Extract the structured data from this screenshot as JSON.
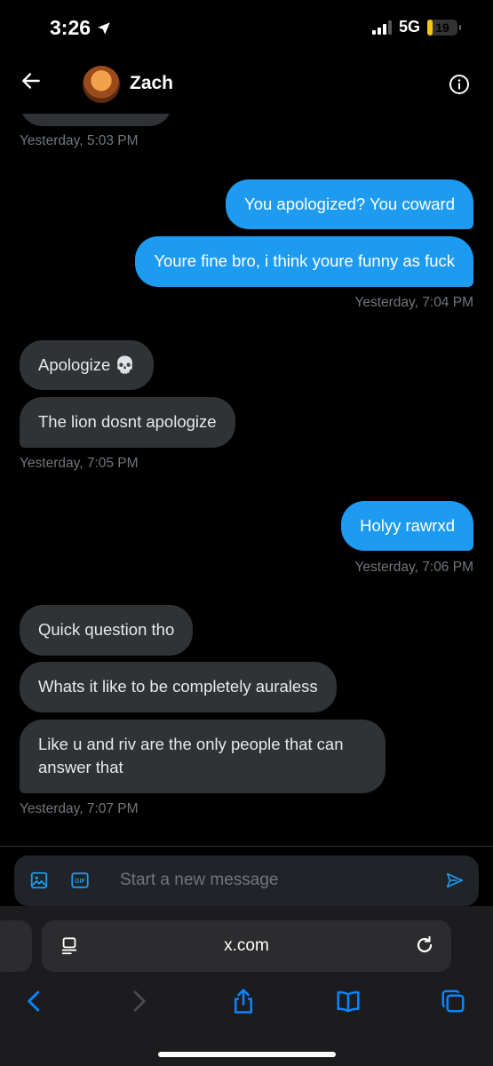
{
  "status": {
    "time": "3:26",
    "network": "5G",
    "battery": "19",
    "battery_level": 0.19
  },
  "header": {
    "contact_name": "Zach"
  },
  "messages": [
    {
      "id": "m1",
      "side": "out",
      "text": "You apologized? You coward"
    },
    {
      "id": "m2",
      "side": "out",
      "text": "Youre fine bro, i think youre funny as fuck"
    },
    {
      "id": "m3",
      "side": "in",
      "text": "Apologize 💀"
    },
    {
      "id": "m4",
      "side": "in",
      "text": "The lion dosnt apologize"
    },
    {
      "id": "m5",
      "side": "out",
      "text": "Holyy rawrxd"
    },
    {
      "id": "m6",
      "side": "in",
      "text": "Quick question tho"
    },
    {
      "id": "m7",
      "side": "in",
      "text": "Whats it like to be completely auraless"
    },
    {
      "id": "m8",
      "side": "in",
      "text": "Like u and riv are the only people that can answer that"
    }
  ],
  "timestamps": {
    "t0": "Yesterday, 5:03 PM",
    "t1": "Yesterday, 7:04 PM",
    "t2": "Yesterday, 7:05 PM",
    "t3": "Yesterday, 7:06 PM",
    "t4": "Yesterday, 7:07 PM"
  },
  "composer": {
    "placeholder": "Start a new message",
    "gif_label": "GIF"
  },
  "browser": {
    "url": "x.com"
  },
  "colors": {
    "accent": "#1d9bf0",
    "incoming_bubble": "#2f3336",
    "muted": "#71767b",
    "safari_accent": "#0a84ff"
  }
}
